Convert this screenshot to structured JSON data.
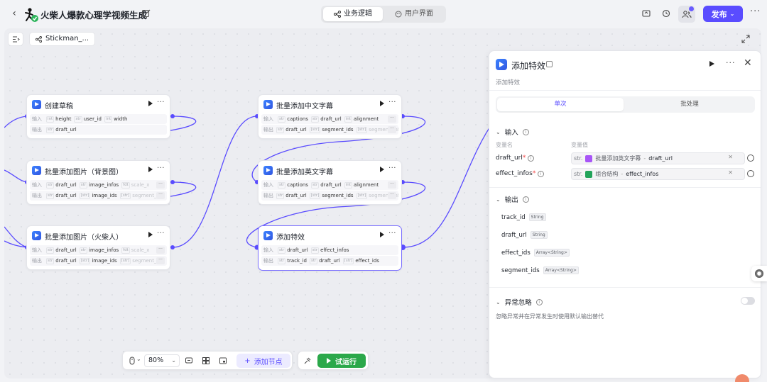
{
  "header": {
    "back_icon": "chevron-left-icon",
    "title": "火柴人爆款心理学视频生成",
    "tabs": [
      {
        "label": "业务逻辑",
        "icon": "flow-icon",
        "active": true
      },
      {
        "label": "用户界面",
        "icon": "palette-icon",
        "active": false
      }
    ],
    "publish_label": "发布",
    "accent_color": "#5a4cff"
  },
  "canvas": {
    "breadcrumb": "Stickman_..."
  },
  "nodes": [
    {
      "title": "创建草稿",
      "input_label": "输入",
      "output_label": "输出",
      "inputs": [
        {
          "type": "int",
          "name": "height"
        },
        {
          "type": "str",
          "name": "user_id"
        },
        {
          "type": "int",
          "name": "width"
        }
      ],
      "outputs": [
        {
          "type": "str",
          "name": "draft_url"
        }
      ]
    },
    {
      "title": "批量添加图片（背景图）",
      "input_label": "输入",
      "output_label": "输出",
      "inputs": [
        {
          "type": "str",
          "name": "draft_url"
        },
        {
          "type": "str",
          "name": "image_infos"
        },
        {
          "type": "fdt",
          "name": "scale_x"
        }
      ],
      "outputs": [
        {
          "type": "str",
          "name": "draft_url"
        },
        {
          "type": "[str]",
          "name": "image_ids"
        },
        {
          "type": "[str]",
          "name": "segment_ids"
        }
      ]
    },
    {
      "title": "批量添加图片（火柴人）",
      "input_label": "输入",
      "output_label": "输出",
      "inputs": [
        {
          "type": "str",
          "name": "draft_url"
        },
        {
          "type": "str",
          "name": "image_infos"
        },
        {
          "type": "fdt",
          "name": "scale_x"
        }
      ],
      "outputs": [
        {
          "type": "str",
          "name": "draft_url"
        },
        {
          "type": "[str]",
          "name": "image_ids"
        },
        {
          "type": "[str]",
          "name": "segment_ids"
        }
      ]
    },
    {
      "title": "批量添加中文字幕",
      "input_label": "输入",
      "output_label": "输出",
      "inputs": [
        {
          "type": "str",
          "name": "captions"
        },
        {
          "type": "str",
          "name": "draft_url"
        },
        {
          "type": "int",
          "name": "alignment"
        }
      ],
      "outputs": [
        {
          "type": "str",
          "name": "draft_url"
        },
        {
          "type": "[str]",
          "name": "segment_ids"
        },
        {
          "type": "[str]",
          "name": "segment_infos"
        }
      ]
    },
    {
      "title": "批量添加英文字幕",
      "input_label": "输入",
      "output_label": "输出",
      "inputs": [
        {
          "type": "str",
          "name": "captions"
        },
        {
          "type": "str",
          "name": "draft_url"
        },
        {
          "type": "int",
          "name": "alignment"
        }
      ],
      "outputs": [
        {
          "type": "str",
          "name": "draft_url"
        },
        {
          "type": "[str]",
          "name": "segment_ids"
        },
        {
          "type": "[str]",
          "name": "segment_infos"
        }
      ]
    },
    {
      "title": "添加特效",
      "input_label": "输入",
      "output_label": "输出",
      "inputs": [
        {
          "type": "str",
          "name": "draft_url"
        },
        {
          "type": "str",
          "name": "effect_infos"
        }
      ],
      "outputs": [
        {
          "type": "str",
          "name": "track_id"
        },
        {
          "type": "str",
          "name": "draft_url"
        },
        {
          "type": "[str]",
          "name": "effect_ids"
        }
      ]
    }
  ],
  "toolbar": {
    "zoom": "80%",
    "add_node_label": "添加节点",
    "run_label": "试运行",
    "run_color": "#2ba84a"
  },
  "panel": {
    "title": "添加特效",
    "subtitle": "添加特效",
    "tabs": {
      "single": "单次",
      "batch": "批处理"
    },
    "input_section": "输入",
    "col_var_name": "变量名",
    "col_var_value": "变量值",
    "params": [
      {
        "name": "draft_url",
        "type": "str.",
        "source": "批量添加英文字幕",
        "field": "draft_url",
        "icon_color": "#a855f7"
      },
      {
        "name": "effect_infos",
        "type": "str.",
        "source": "组合结构",
        "field": "effect_infos",
        "icon_color": "#22a35a"
      }
    ],
    "output_section": "输出",
    "outputs": [
      {
        "name": "track_id",
        "type": "String"
      },
      {
        "name": "draft_url",
        "type": "String"
      },
      {
        "name": "effect_ids",
        "type": "Array<String>"
      },
      {
        "name": "segment_ids",
        "type": "Array<String>"
      }
    ],
    "ignore_section": "异常忽略",
    "ignore_desc": "忽略异常并在异常发生时使用默认输出替代",
    "ignore_enabled": false
  }
}
